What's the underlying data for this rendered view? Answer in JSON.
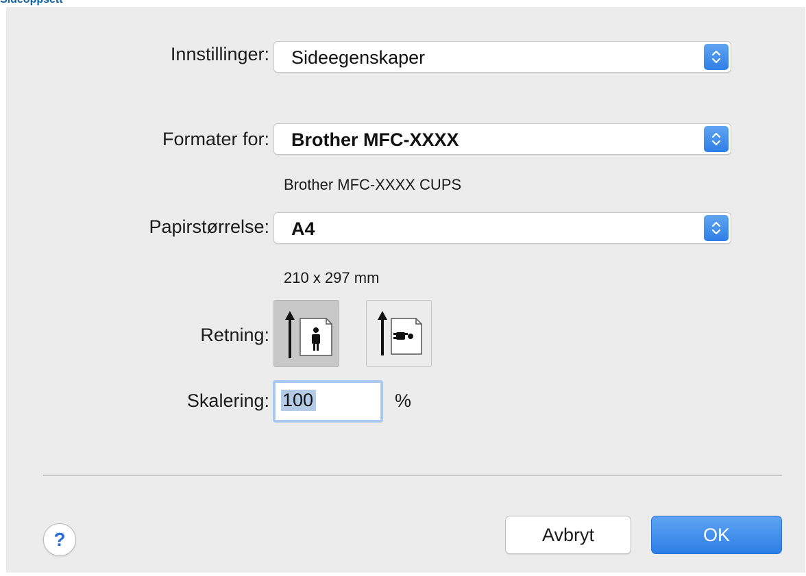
{
  "heading": "Sideoppsett",
  "settings": {
    "label": "Innstillinger:",
    "value": "Sideegenskaper"
  },
  "format_for": {
    "label": "Formater for:",
    "value": "Brother MFC-XXXX",
    "description": "Brother MFC-XXXX CUPS"
  },
  "paper_size": {
    "label": "Papirstørrelse:",
    "value": "A4",
    "description": "210 x 297 mm"
  },
  "orientation": {
    "label": "Retning:",
    "options": [
      {
        "icon": "portrait-orientation-icon",
        "selected": true
      },
      {
        "icon": "landscape-orientation-icon",
        "selected": false
      }
    ]
  },
  "scaling": {
    "label": "Skalering:",
    "value": "100",
    "unit": "%"
  },
  "buttons": {
    "help": "?",
    "cancel": "Avbryt",
    "ok": "OK"
  },
  "colors": {
    "accent": "#2f7fe6",
    "dialog_bg": "#ececec",
    "focus_ring": "#a9c9f1"
  }
}
